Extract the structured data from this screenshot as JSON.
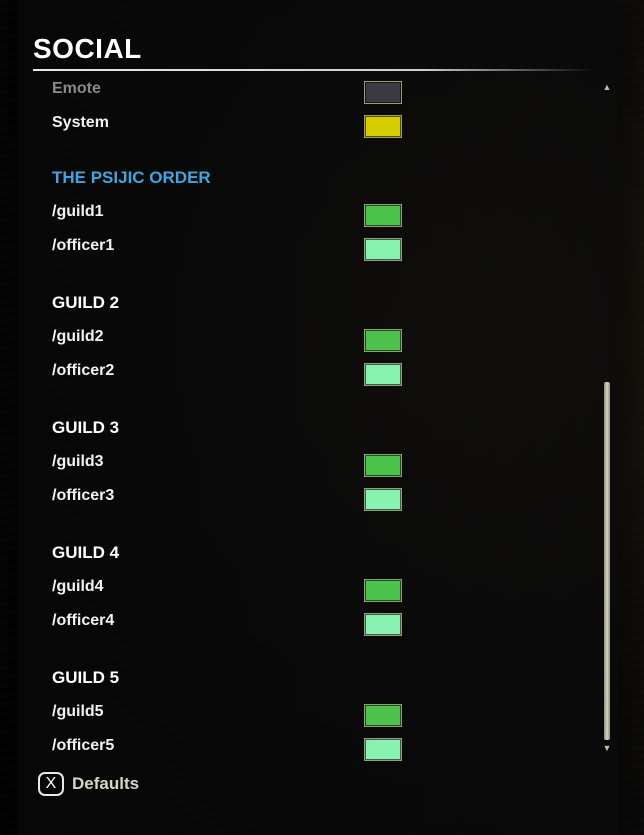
{
  "title": "SOCIAL",
  "partial_rows": [
    {
      "label": "Emote",
      "color": "#3a3a42",
      "dim": true
    },
    {
      "label": "System",
      "color": "#d6cd00"
    }
  ],
  "guilds": [
    {
      "name": "THE PSIJIC ORDER",
      "accent": true,
      "rows": [
        {
          "label": "/guild1",
          "color": "#4bc24b"
        },
        {
          "label": "/officer1",
          "color": "#8af2b0"
        }
      ]
    },
    {
      "name": "GUILD 2",
      "rows": [
        {
          "label": "/guild2",
          "color": "#4bc24b"
        },
        {
          "label": "/officer2",
          "color": "#8af2b0"
        }
      ]
    },
    {
      "name": "GUILD 3",
      "rows": [
        {
          "label": "/guild3",
          "color": "#4bc24b"
        },
        {
          "label": "/officer3",
          "color": "#8af2b0"
        }
      ]
    },
    {
      "name": "GUILD 4",
      "rows": [
        {
          "label": "/guild4",
          "color": "#4bc24b"
        },
        {
          "label": "/officer4",
          "color": "#8af2b0"
        }
      ]
    },
    {
      "name": "GUILD 5",
      "rows": [
        {
          "label": "/guild5",
          "color": "#4bc24b"
        },
        {
          "label": "/officer5",
          "color": "#8af2b0"
        }
      ]
    }
  ],
  "footer": {
    "key": "X",
    "label": "Defaults"
  },
  "icons": {
    "scroll_up": "arrow-up-icon",
    "scroll_down": "arrow-down-icon",
    "key": "x-button-icon"
  }
}
